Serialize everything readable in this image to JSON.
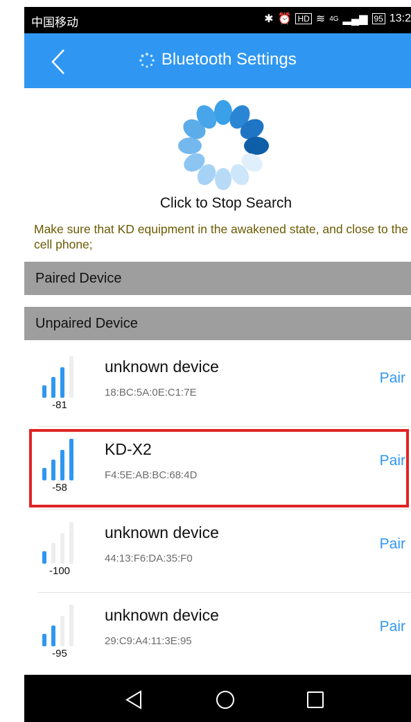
{
  "status_bar": {
    "carrier": "中国移动",
    "hd_badge": "HD",
    "network": "4G",
    "battery": "95",
    "time": "13:2"
  },
  "app_bar": {
    "title": "Bluetooth Settings"
  },
  "search": {
    "stop_label": "Click to Stop Search",
    "hint": "Make sure that KD equipment in the awakened state, and close to the cell phone;"
  },
  "sections": {
    "paired": "Paired Device",
    "unpaired": "Unpaired Device"
  },
  "devices": [
    {
      "name": "unknown device",
      "mac": "18:BC:5A:0E:C1:7E",
      "rssi": "-81",
      "bars_active": 3,
      "action": "Pair"
    },
    {
      "name": "KD-X2",
      "mac": "F4:5E:AB:BC:68:4D",
      "rssi": "-58",
      "bars_active": 4,
      "action": "Pair"
    },
    {
      "name": "unknown device",
      "mac": "44:13:F6:DA:35:F0",
      "rssi": "-100",
      "bars_active": 1,
      "action": "Pair"
    },
    {
      "name": "unknown device",
      "mac": "29:C9:A4:11:3E:95",
      "rssi": "-95",
      "bars_active": 2,
      "action": "Pair"
    }
  ],
  "colors": {
    "accent": "#2f97f2",
    "section_bg": "#9e9e9e",
    "hint_text": "#6b5a00",
    "highlight": "#e02424"
  },
  "icons": {
    "back": "back-arrow-icon",
    "spinner": "loading-spinner-icon",
    "signal": "signal-strength-icon",
    "nav_back": "nav-back-icon",
    "nav_home": "nav-home-icon",
    "nav_recent": "nav-recents-icon"
  }
}
